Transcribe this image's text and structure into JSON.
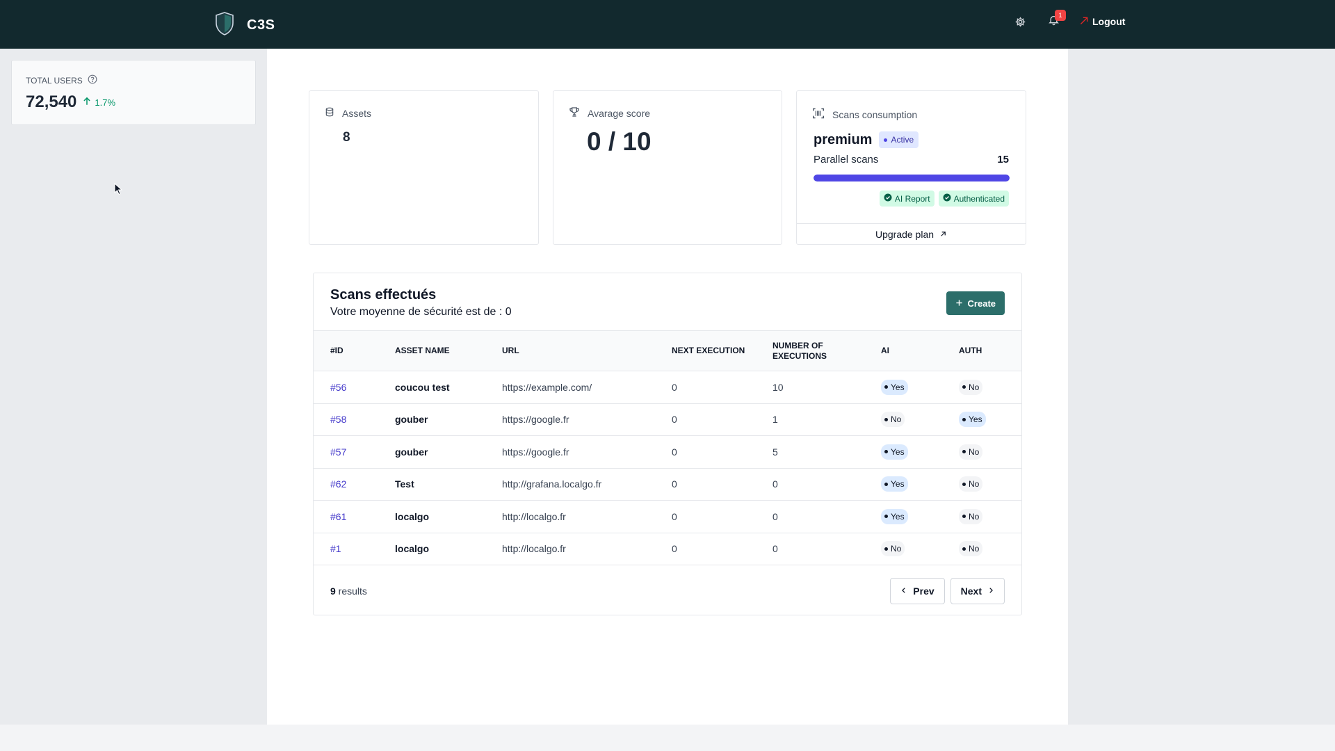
{
  "header": {
    "app_name": "C3S",
    "notification_count": "1",
    "logout_label": "Logout"
  },
  "sidebar": {
    "total_users_label": "TOTAL USERS",
    "total_users_value": "72,540",
    "total_users_delta": "1.7%"
  },
  "stats": {
    "assets_label": "Assets",
    "assets_value": "8",
    "score_label": "Avarage score",
    "score_value": "0 / 10",
    "scans_label": "Scans consumption",
    "plan_name": "premium",
    "plan_status": "Active",
    "parallel_label": "Parallel scans",
    "parallel_value": "15",
    "parallel_progress": 1.0,
    "features": [
      "AI Report",
      "Authenticated"
    ],
    "upgrade_label": "Upgrade plan"
  },
  "scans": {
    "title": "Scans effectués",
    "subtitle": "Votre moyenne de sécurité est de : 0",
    "create_label": "Create",
    "columns": [
      "#ID",
      "ASSET NAME",
      "URL",
      "NEXT EXECUTION",
      "NUMBER OF EXECUTIONS",
      "AI",
      "AUTH"
    ],
    "rows": [
      {
        "id": "#56",
        "name": "coucou test",
        "url": "https://example.com/",
        "next": "0",
        "count": "10",
        "ai": "Yes",
        "auth": "No"
      },
      {
        "id": "#58",
        "name": "gouber",
        "url": "https://google.fr",
        "next": "0",
        "count": "1",
        "ai": "No",
        "auth": "Yes"
      },
      {
        "id": "#57",
        "name": "gouber",
        "url": "https://google.fr",
        "next": "0",
        "count": "5",
        "ai": "Yes",
        "auth": "No"
      },
      {
        "id": "#62",
        "name": "Test",
        "url": "http://grafana.localgo.fr",
        "next": "0",
        "count": "0",
        "ai": "Yes",
        "auth": "No"
      },
      {
        "id": "#61",
        "name": "localgo",
        "url": "http://localgo.fr",
        "next": "0",
        "count": "0",
        "ai": "Yes",
        "auth": "No"
      },
      {
        "id": "#1",
        "name": "localgo",
        "url": "http://localgo.fr",
        "next": "0",
        "count": "0",
        "ai": "No",
        "auth": "No"
      }
    ],
    "results_count": "9",
    "results_label": " results",
    "prev_label": "Prev",
    "next_label": "Next"
  },
  "colors": {
    "topbar": "#12292e",
    "accent": "#4f46e5",
    "primary_button": "#2c6e6a",
    "success": "#059669",
    "badge_red": "#ef4444"
  },
  "icons": {
    "logo": "shield-icon",
    "settings": "gear-icon",
    "notifications": "bell-icon",
    "logout": "logout-icon",
    "help": "question-circle-icon",
    "delta": "arrow-up-icon",
    "assets": "database-icon",
    "score": "trophy-icon",
    "scans": "barcode-scan-icon",
    "upgrade": "arrow-up-right-icon",
    "create": "plus-icon",
    "prev": "chevron-left-icon",
    "next": "chevron-right-icon",
    "feature_check": "check-circle-icon"
  }
}
